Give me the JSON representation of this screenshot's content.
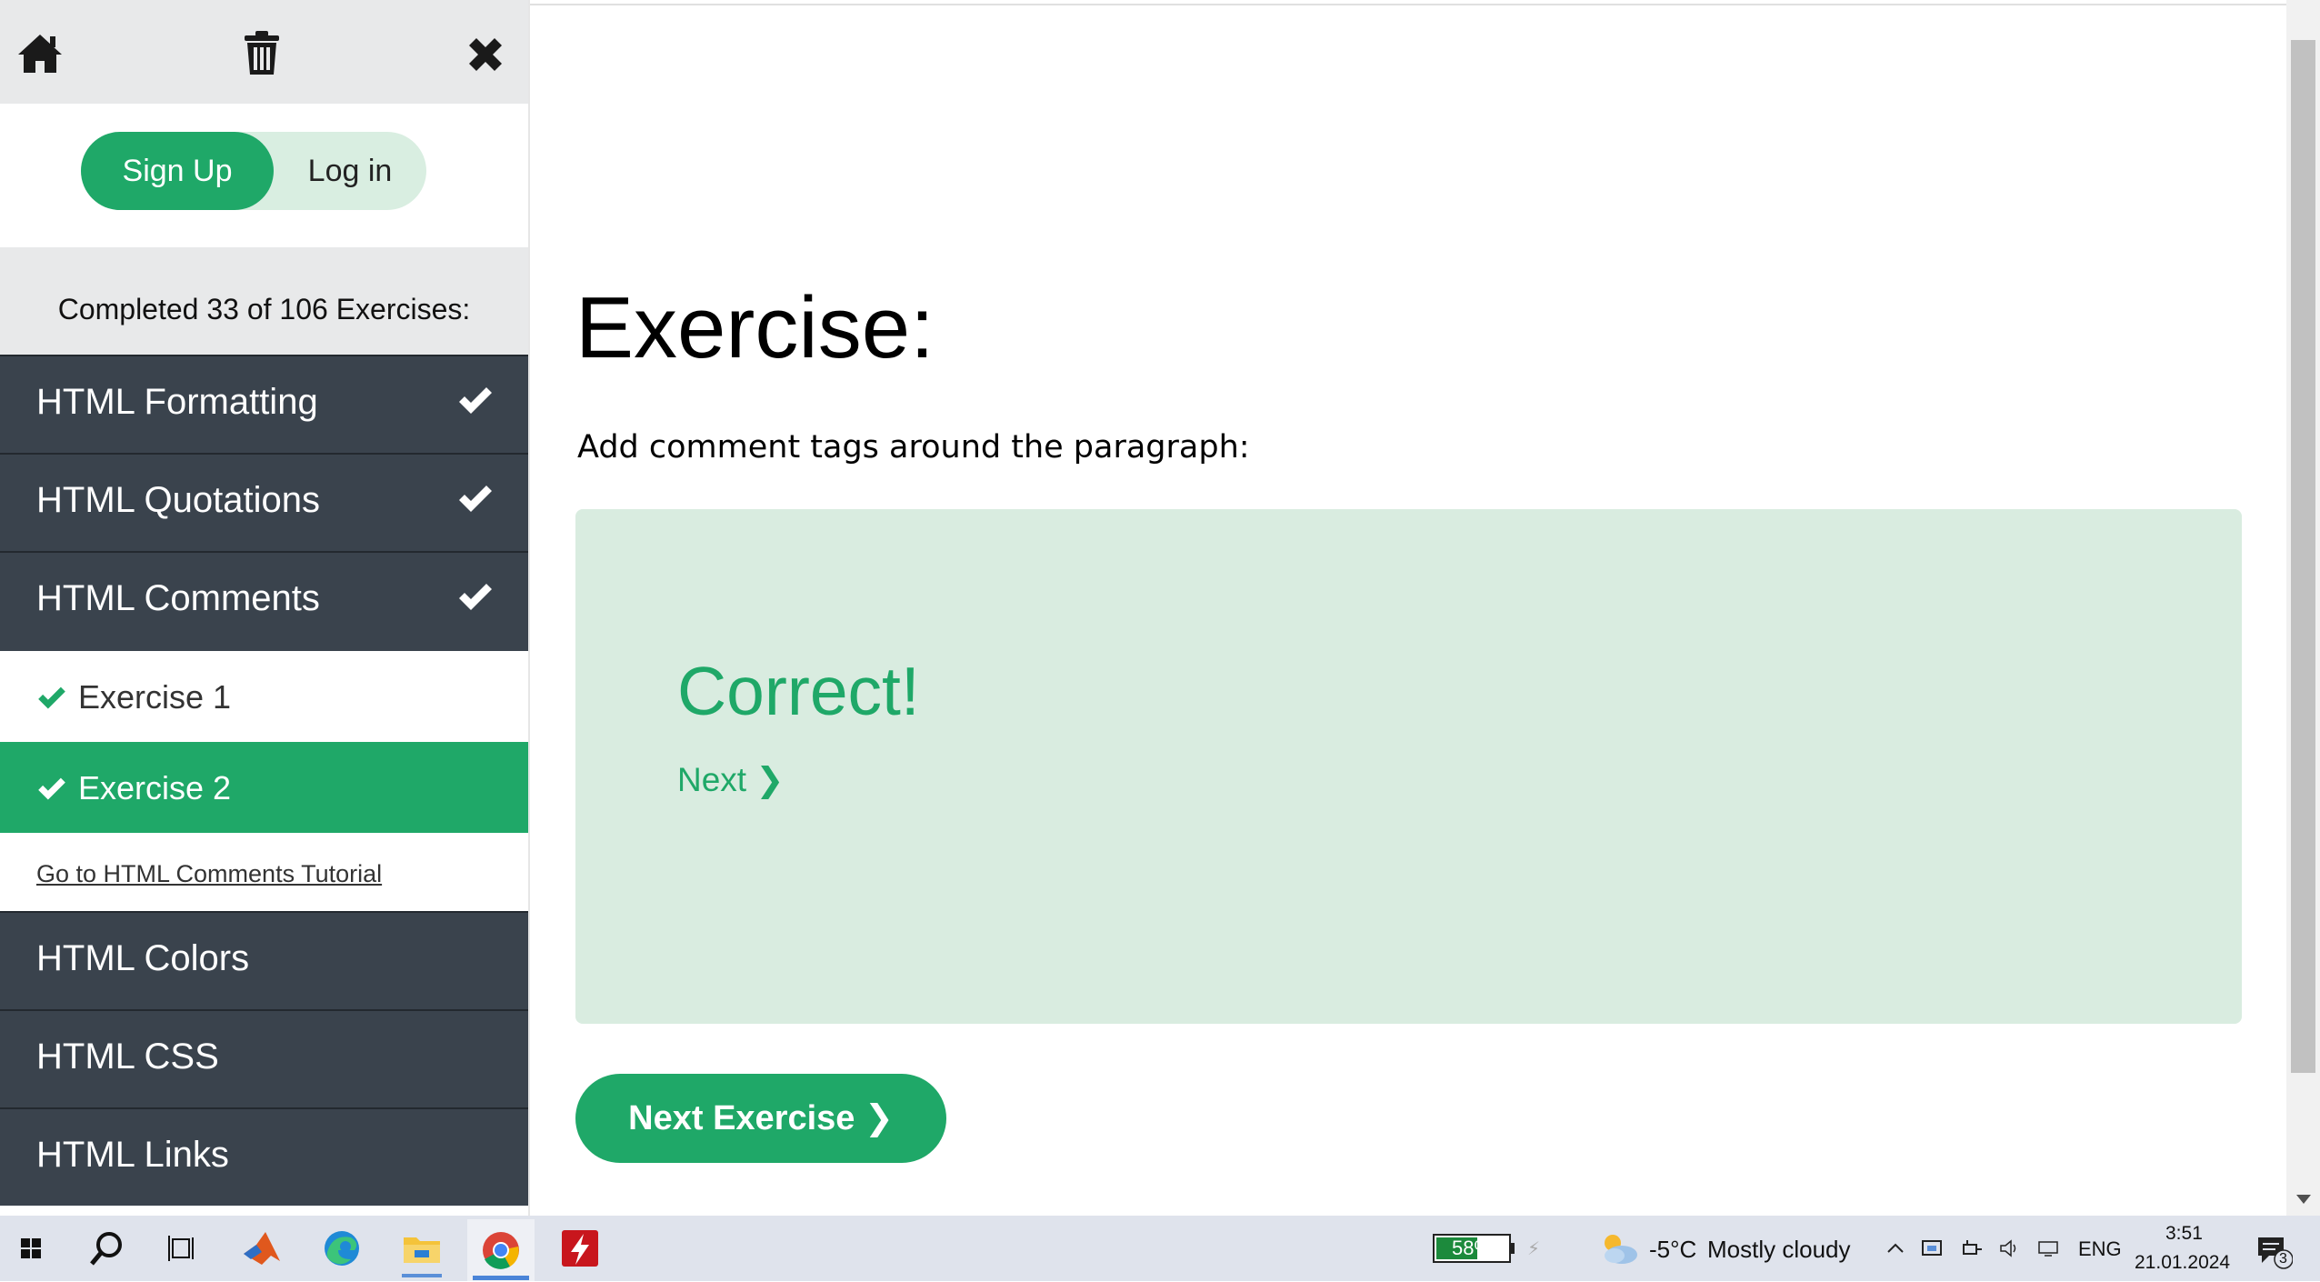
{
  "toolbar": {
    "home_icon": "home-icon",
    "trash_icon": "trash-icon",
    "close_icon": "close-icon"
  },
  "auth": {
    "signup_label": "Sign Up",
    "login_label": "Log in"
  },
  "progress": {
    "text": "Completed 33 of 106 Exercises:",
    "completed": 33,
    "total": 106
  },
  "categories_top": [
    {
      "label": "HTML Formatting",
      "completed": true
    },
    {
      "label": "HTML Quotations",
      "completed": true
    },
    {
      "label": "HTML Comments",
      "completed": true,
      "expanded": true
    }
  ],
  "exercises": [
    {
      "label": "Exercise 1",
      "completed": true,
      "active": false
    },
    {
      "label": "Exercise 2",
      "completed": true,
      "active": true
    }
  ],
  "tutorial_link": "Go to HTML Comments Tutorial",
  "categories_bottom": [
    {
      "label": "HTML Colors"
    },
    {
      "label": "HTML CSS"
    },
    {
      "label": "HTML Links"
    }
  ],
  "main": {
    "title": "Exercise:",
    "description": "Add comment tags around the paragraph:",
    "result": "Correct!",
    "next_link": "Next ❯",
    "next_exercise_button": "Next Exercise ❯"
  },
  "taskbar": {
    "battery_percent": "58%",
    "battery_level": 0.58,
    "weather_temp": "-5°C",
    "weather_desc": "Mostly cloudy",
    "language": "ENG",
    "time": "3:51",
    "date": "21.01.2024",
    "notification_count": "3"
  },
  "colors": {
    "accent": "#1fa868",
    "sidebar_dark": "#3a434d",
    "light_green": "#d9ece0"
  }
}
